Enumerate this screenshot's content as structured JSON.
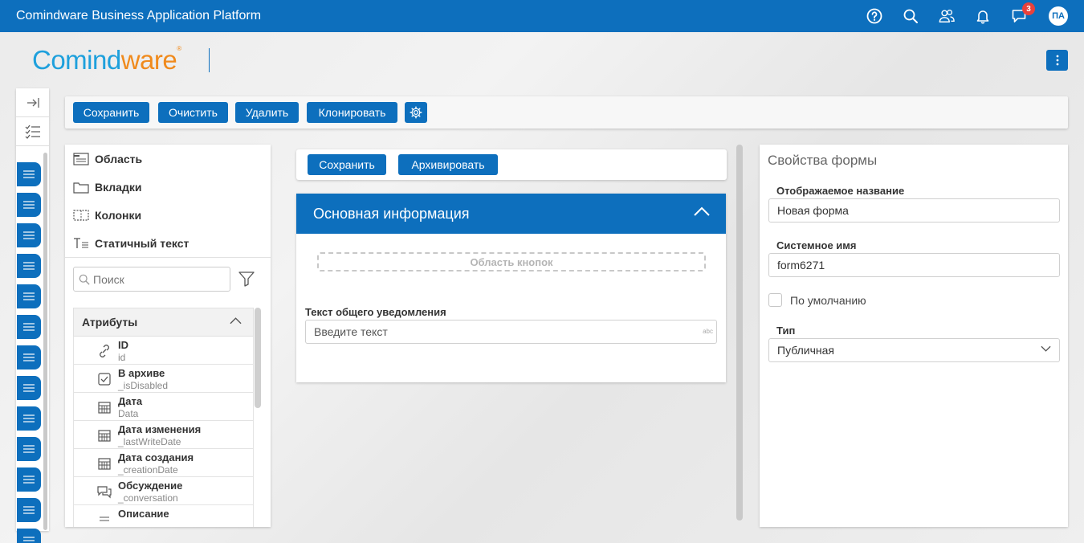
{
  "topbar": {
    "title": "Comindware Business Application Platform",
    "icons": [
      "help-icon",
      "search-icon",
      "users-icon",
      "bell-icon",
      "chat-icon"
    ],
    "notification_count": "3",
    "user_initials": "ПА"
  },
  "logo": {
    "part1": "Comind",
    "part2": "ware",
    "mark": "®"
  },
  "toolbar": {
    "save": "Сохранить",
    "clear": "Очистить",
    "delete": "Удалить",
    "clone": "Клонировать"
  },
  "elements": {
    "area": "Область",
    "tabs": "Вкладки",
    "columns": "Колонки",
    "static_text": "Статичный текст"
  },
  "search": {
    "placeholder": "Поиск"
  },
  "attributes": {
    "header": "Атрибуты",
    "items": [
      {
        "name": "ID",
        "id": "id",
        "icon": "link-icon"
      },
      {
        "name": "В архиве",
        "id": "_isDisabled",
        "icon": "checkbox-icon"
      },
      {
        "name": "Дата",
        "id": "Data",
        "icon": "calendar-icon"
      },
      {
        "name": "Дата изменения",
        "id": "_lastWriteDate",
        "icon": "calendar-icon"
      },
      {
        "name": "Дата создания",
        "id": "_creationDate",
        "icon": "calendar-icon"
      },
      {
        "name": "Обсуждение",
        "id": "_conversation",
        "icon": "comments-icon"
      },
      {
        "name": "Описание",
        "id": "",
        "icon": "text-icon"
      }
    ]
  },
  "form_toolbar": {
    "save": "Сохранить",
    "archive": "Архивировать"
  },
  "form": {
    "section_title": "Основная информация",
    "button_area": "Область кнопок",
    "field_label": "Текст общего уведомления",
    "field_placeholder": "Введите текст",
    "field_type": "abc"
  },
  "properties": {
    "title": "Свойства формы",
    "display_name_label": "Отображаемое название",
    "display_name_value": "Новая форма",
    "system_name_label": "Системное имя",
    "system_name_value": "form6271",
    "default_label": "По умолчанию",
    "type_label": "Тип",
    "type_value": "Публичная"
  },
  "colors": {
    "primary": "#0d6fbd",
    "logo_blue": "#1ea0dc",
    "logo_orange": "#f08a1c",
    "badge": "#e8413c"
  }
}
